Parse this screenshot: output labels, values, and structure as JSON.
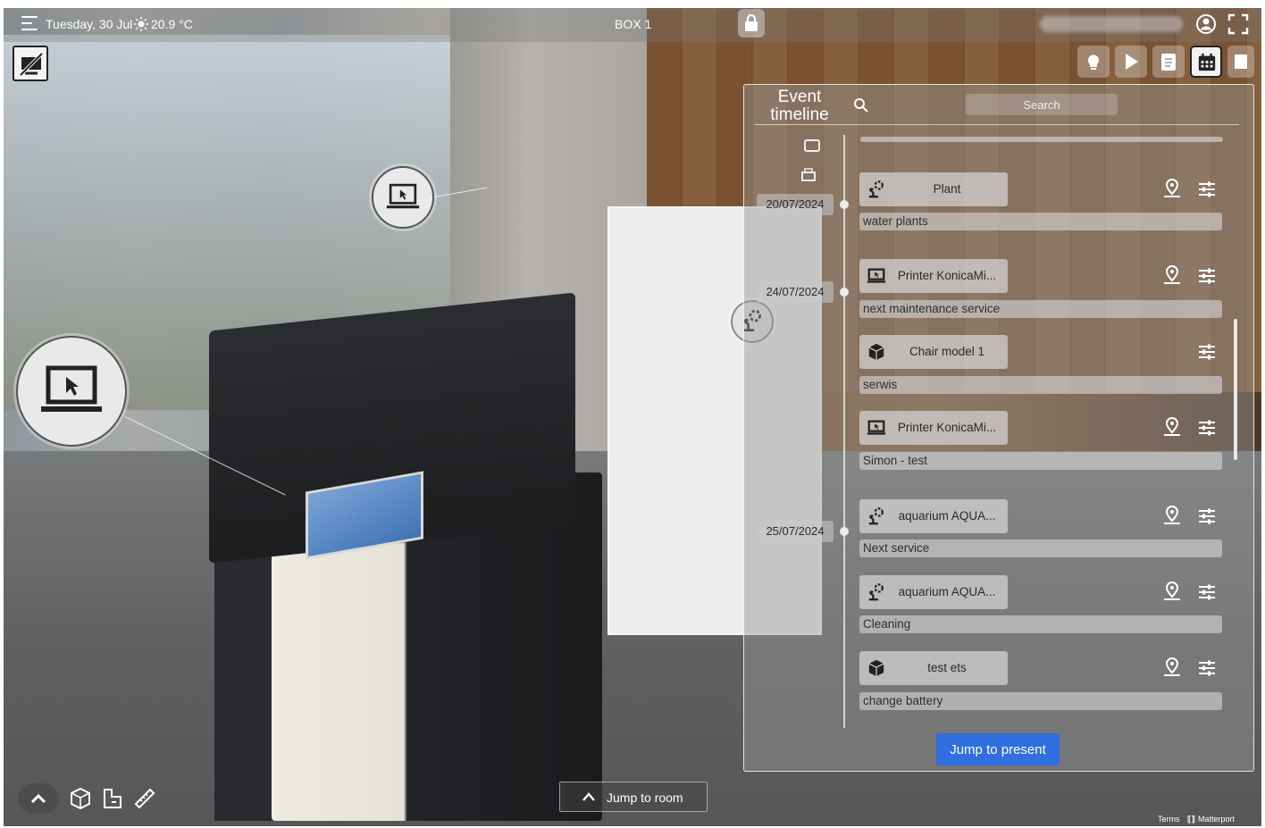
{
  "topbar": {
    "date": "Tuesday, 30 Jul",
    "temperature": "20.9 °C",
    "title": "BOX 1"
  },
  "timeline": {
    "title": "Event timeline",
    "search_placeholder": "Search",
    "jump_label": "Jump to present",
    "dates": [
      "20/07/2024",
      "24/07/2024",
      "25/07/2024"
    ],
    "events": [
      {
        "icon": "plant-icon",
        "name": "Plant",
        "description": "water plants",
        "has_pin": true
      },
      {
        "icon": "laptop-icon",
        "name": "Printer KonicaMi...",
        "description": "next maintenance service",
        "has_pin": true
      },
      {
        "icon": "cube-icon",
        "name": "Chair model 1",
        "description": "serwis",
        "has_pin": false
      },
      {
        "icon": "laptop-icon",
        "name": "Printer KonicaMi...",
        "description": "Simon - test",
        "has_pin": true
      },
      {
        "icon": "plant-icon",
        "name": "aquarium AQUA...",
        "description": "Next service",
        "has_pin": true
      },
      {
        "icon": "plant-icon",
        "name": "aquarium AQUA...",
        "description": "Cleaning",
        "has_pin": true
      },
      {
        "icon": "cube-icon",
        "name": "test ets",
        "description": "change battery",
        "has_pin": true
      }
    ]
  },
  "bottom": {
    "jump_room_label": "Jump to room"
  },
  "footer": {
    "terms": "Terms",
    "brand": "Matterport"
  },
  "colors": {
    "accent_button": "#2f6fe0",
    "panel_bg": "rgba(150,150,150,0.45)"
  }
}
